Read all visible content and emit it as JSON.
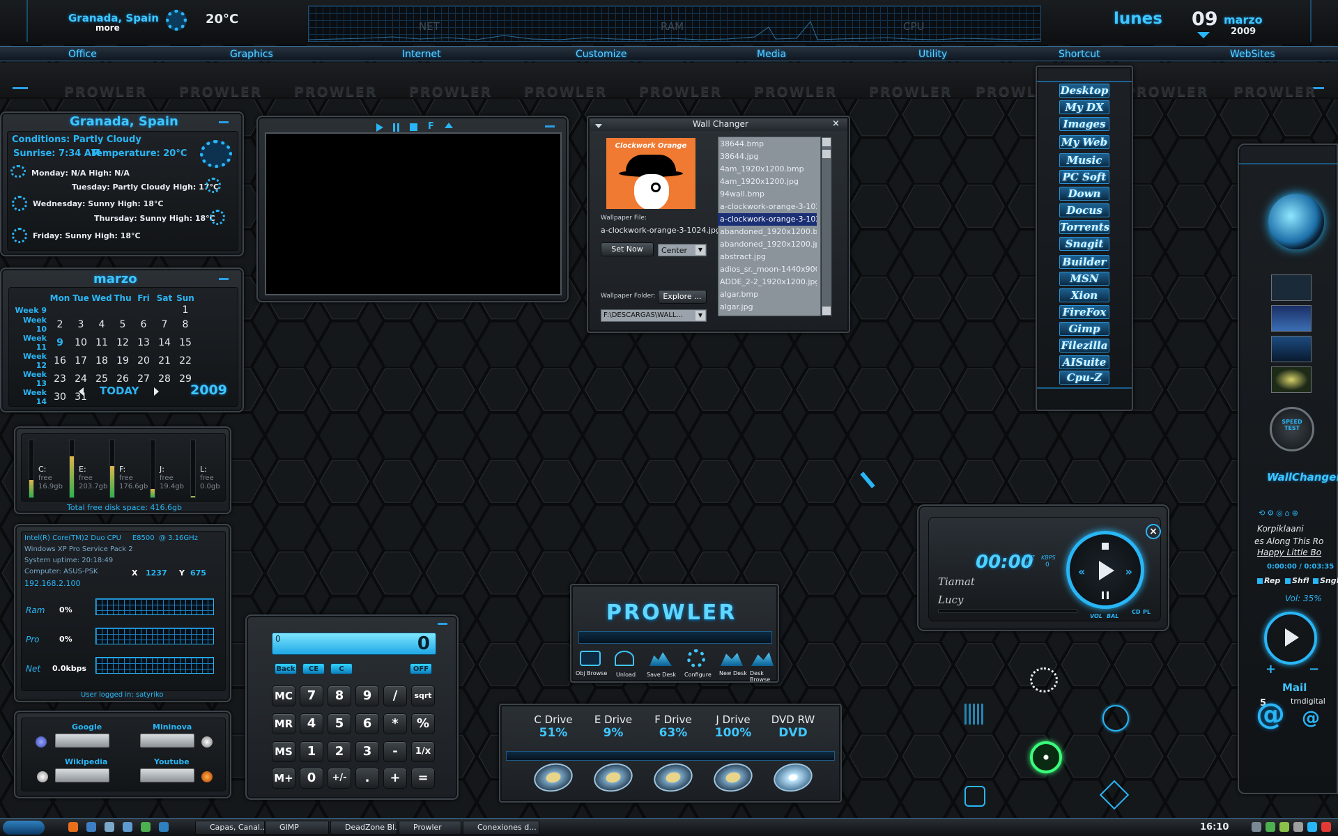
{
  "topbar": {
    "location": "Granada, Spain",
    "more": "more",
    "temp": "20°C",
    "graphs": [
      "NET",
      "RAM",
      "CPU"
    ],
    "weekday": "lunes",
    "day": "09",
    "month": "marzo",
    "year": "2009"
  },
  "menu": [
    "Office",
    "Graphics",
    "Internet",
    "Customize",
    "Media",
    "Utility",
    "Shortcut",
    "WebSites"
  ],
  "watermark": "PROWLER",
  "weather": {
    "title": "Granada, Spain",
    "conditions": "Conditions: Partly Cloudy",
    "sunrise": "Sunrise: 7:34 AM",
    "temperature": "Temperature: 20°C",
    "days": [
      "Monday: N/A High: N/A",
      "Tuesday: Partly Cloudy High: 17°C",
      "Wednesday: Sunny High: 18°C",
      "Thursday: Sunny High: 18°C",
      "Friday: Sunny High: 18°C"
    ]
  },
  "calendar": {
    "title": "marzo",
    "headers": [
      "Mon",
      "Tue",
      "Wed",
      "Thu",
      "Fri",
      "Sat",
      "Sun"
    ],
    "weeks": [
      {
        "label": "Week 9",
        "days": [
          "",
          "",
          "",
          "",
          "",
          "",
          "1"
        ]
      },
      {
        "label": "Week 10",
        "days": [
          "2",
          "3",
          "4",
          "5",
          "6",
          "7",
          "8"
        ]
      },
      {
        "label": "Week 11",
        "days": [
          "9",
          "10",
          "11",
          "12",
          "13",
          "14",
          "15"
        ]
      },
      {
        "label": "Week 12",
        "days": [
          "16",
          "17",
          "18",
          "19",
          "20",
          "21",
          "22"
        ]
      },
      {
        "label": "Week 13",
        "days": [
          "23",
          "24",
          "25",
          "26",
          "27",
          "28",
          "29"
        ]
      },
      {
        "label": "Week 14",
        "days": [
          "30",
          "31",
          "",
          "",
          "",
          "",
          ""
        ]
      }
    ],
    "today": "TODAY",
    "year": "2009"
  },
  "disks": {
    "items": [
      {
        "letter": "C:",
        "free": "free",
        "size": "16.9gb",
        "level": 0.3
      },
      {
        "letter": "E:",
        "free": "free",
        "size": "203.7gb",
        "level": 0.72
      },
      {
        "letter": "F:",
        "free": "free",
        "size": "176.6gb",
        "level": 0.55
      },
      {
        "letter": "J:",
        "free": "free",
        "size": "19.4gb",
        "level": 0.15
      },
      {
        "letter": "L:",
        "free": "free",
        "size": "0.0gb",
        "level": 0.02
      }
    ],
    "total": "Total free disk space: 416.6gb"
  },
  "sysinfo": {
    "cpu": "Intel(R) Core(TM)2 Duo CPU     E8500  @ 3.16GHz",
    "os": "Windows XP Pro Service Pack 2",
    "uptime": "System uptime: 20:18:49",
    "computer": "Computer: ASUS-PSK",
    "x_label": "X",
    "x_value": "1237",
    "y_label": "Y",
    "y_value": "675",
    "ip": "192.168.2.100",
    "rows": [
      {
        "label": "Ram",
        "value": "0%"
      },
      {
        "label": "Pro",
        "value": "0%"
      },
      {
        "label": "Net",
        "value": "0.0kbps"
      }
    ],
    "user": "User logged in: satyriko"
  },
  "search": {
    "google": "Google",
    "mininova": "Mininova",
    "wikipedia": "Wikipedia",
    "youtube": "Youtube"
  },
  "calculator": {
    "small_display": "0",
    "display": "0",
    "top_keys": [
      "Back",
      "CE",
      "C",
      "OFF"
    ],
    "rows": [
      [
        "MC",
        "7",
        "8",
        "9",
        "/",
        "sqrt"
      ],
      [
        "MR",
        "4",
        "5",
        "6",
        "*",
        "%"
      ],
      [
        "MS",
        "1",
        "2",
        "3",
        "-",
        "1/x"
      ],
      [
        "M+",
        "0",
        "+/-",
        ".",
        "+",
        "="
      ]
    ]
  },
  "wallchanger": {
    "title": "Wall Changer",
    "album_text": "Clockwork Orange",
    "file_label": "Wallpaper File:",
    "file_value": "a-clockwork-orange-3-1024.jpg",
    "set_now": "Set Now",
    "mode": "Center",
    "folder_label": "Wallpaper Folder:",
    "explore": "Explore ...",
    "folder_value": "F:\\DESCARGAS\\WALL...",
    "files": [
      "38644.bmp",
      "38644.jpg",
      "4am_1920x1200.bmp",
      "4am_1920x1200.jpg",
      "94wall.bmp",
      "a-clockwork-orange-3-1024...",
      "a-clockwork-orange-3-1024...",
      "abandoned_1920x1200.bmp",
      "abandoned_1920x1200.jpg",
      "abstract.jpg",
      "adios_sr._moon-1440x900.j...",
      "ADDE_2-2_1920x1200.jpg",
      "algar.bmp",
      "algar.jpg"
    ],
    "selected_index": 6
  },
  "shortcuts": [
    "Desktop",
    "My DX",
    "Images",
    "My Web",
    "Music",
    "PC Soft",
    "Down",
    "Docus",
    "Torrents",
    "Snagit",
    "Builder",
    "MSN",
    "Xion",
    "FireFox",
    "Gimp",
    "Filezilla",
    "AISuite",
    "Cpu-Z"
  ],
  "prowler_dock": {
    "logo": "PROWLER",
    "buttons": [
      "Obj Browse",
      "Unload",
      "Save Desk",
      "Configure",
      "New Desk",
      "Desk Browse"
    ]
  },
  "drives": [
    {
      "name": "C Drive",
      "value": "51%"
    },
    {
      "name": "E Drive",
      "value": "9%"
    },
    {
      "name": "F Drive",
      "value": "63%"
    },
    {
      "name": "J Drive",
      "value": "100%"
    },
    {
      "name": "DVD RW",
      "value": "DVD"
    }
  ],
  "player": {
    "time": "00:00",
    "khz": "KHZ",
    "kbps": "KBPS",
    "khz_val": "0",
    "kbps_val": "0",
    "artist": "Tiamat",
    "track": "Lucy",
    "vol": "VOL",
    "bal": "BAL",
    "cd": "CD",
    "pl": "PL"
  },
  "sidebar": {
    "speed_test": "SPEED TEST",
    "wallchanger": "WallChanger",
    "artist": "Korpiklaani",
    "song1": "es Along This Ro",
    "song2": "Happy Little Bo",
    "time": "0:00:00 / 0:03:35",
    "rep": "Rep",
    "shfl": "Shfl",
    "sngl": "Sngl",
    "vol": "Vol: 35%",
    "plus": "+",
    "minus": "−",
    "mail": "Mail",
    "mail_count": "5",
    "mail_account": "trndigital"
  },
  "taskbar": {
    "tasks": [
      "Capas, Canal...",
      "GIMP",
      "DeadZone Bl...",
      "Prowler",
      "Conexiones d..."
    ],
    "clock": "16:10"
  },
  "colors": {
    "accent": "#29b6f6",
    "panel": "#24292e",
    "background": "#15181b"
  }
}
